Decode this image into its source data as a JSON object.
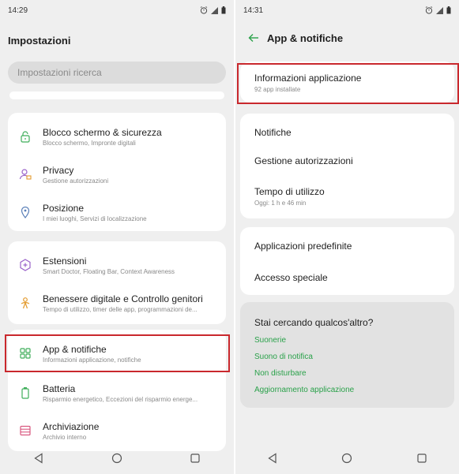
{
  "left": {
    "status": {
      "time": "14:29"
    },
    "title": "Impostazioni",
    "search": {
      "placeholder": "Impostazioni ricerca"
    },
    "group1": [
      {
        "title": "Blocco schermo & sicurezza",
        "subtitle": "Blocco schermo, Impronte digitali",
        "icon": "lock-icon"
      },
      {
        "title": "Privacy",
        "subtitle": "Gestione autorizzazioni",
        "icon": "privacy-user-icon"
      },
      {
        "title": "Posizione",
        "subtitle": "I miei luoghi, Servizi di localizzazione",
        "icon": "location-pin-icon"
      }
    ],
    "group2": [
      {
        "title": "Estensioni",
        "subtitle": "Smart Doctor, Floating Bar, Context Awareness",
        "icon": "extension-gear-icon"
      },
      {
        "title": "Benessere digitale e Controllo genitori",
        "subtitle": "Tempo di utilizzo, timer delle app, programmazioni de...",
        "icon": "wellbeing-icon"
      }
    ],
    "group3": [
      {
        "title": "App & notifiche",
        "subtitle": "Informazioni applicazione, notifiche",
        "icon": "apps-grid-icon"
      },
      {
        "title": "Batteria",
        "subtitle": "Risparmio energetico, Eccezioni del risparmio energe...",
        "icon": "battery-icon"
      },
      {
        "title": "Archiviazione",
        "subtitle": "Archivio interno",
        "icon": "storage-icon"
      }
    ]
  },
  "right": {
    "status": {
      "time": "14:31"
    },
    "title": "App & notifiche",
    "app_info": {
      "title": "Informazioni applicazione",
      "subtitle": "92 app installate"
    },
    "group2": [
      {
        "title": "Notifiche",
        "subtitle": ""
      },
      {
        "title": "Gestione autorizzazioni",
        "subtitle": ""
      },
      {
        "title": "Tempo di utilizzo",
        "subtitle": "Oggi: 1 h e 46 min"
      }
    ],
    "group3": [
      {
        "title": "Applicazioni predefinite"
      },
      {
        "title": "Accesso speciale"
      }
    ],
    "suggest": {
      "heading": "Stai cercando qualcos'altro?",
      "links": [
        "Suonerie",
        "Suono di notifica",
        "Non disturbare",
        "Aggiornamento applicazione"
      ]
    }
  },
  "colors": {
    "accent_green": "#2aa14a",
    "highlight_red": "#c9282d",
    "icon_green": "#3fae5a",
    "icon_orange": "#e39b2f",
    "icon_purple": "#9a63c9",
    "icon_pink": "#d9587f"
  }
}
